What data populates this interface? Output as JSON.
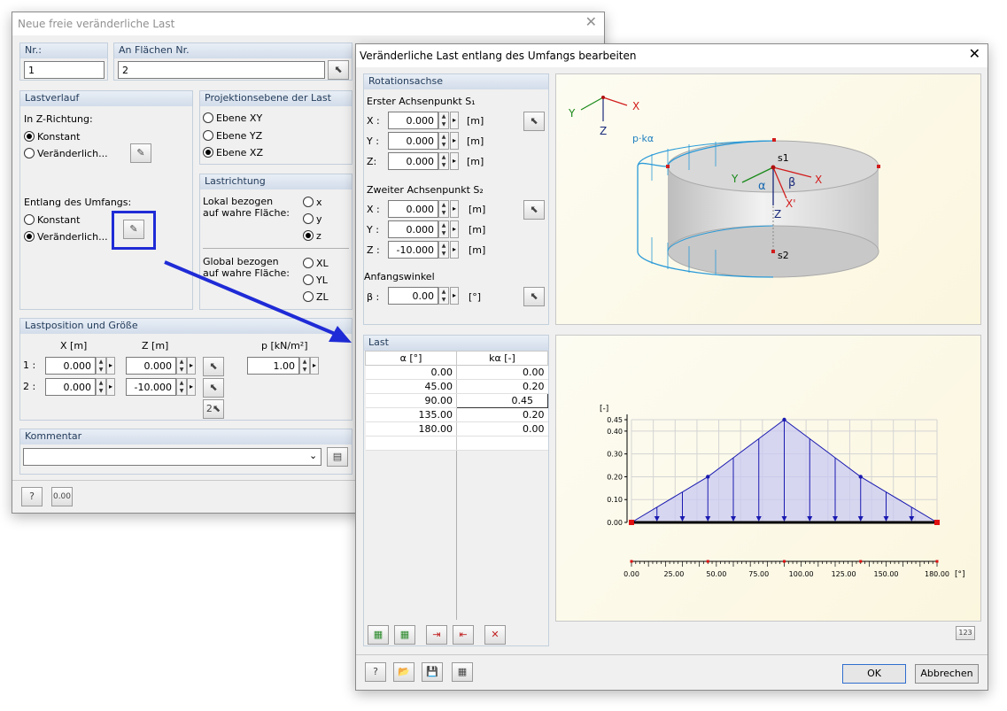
{
  "w1": {
    "title": "Neue freie veränderliche Last",
    "nr_label": "Nr.:",
    "nr_value": "1",
    "faces_label": "An Flächen Nr.",
    "faces_value": "2",
    "lastverlauf": {
      "title": "Lastverlauf",
      "z_label": "In Z-Richtung:",
      "konstant": "Konstant",
      "veraenderlich": "Veränderlich...",
      "umfang_label": "Entlang des Umfangs:"
    },
    "projektion": {
      "title": "Projektionsebene der Last",
      "xy": "Ebene XY",
      "yz": "Ebene YZ",
      "xz": "Ebene XZ"
    },
    "richtung": {
      "title": "Lastrichtung",
      "lokal": "Lokal bezogen auf wahre Fläche:",
      "x": "x",
      "y": "y",
      "z": "z",
      "global": "Global bezogen auf wahre Fläche:",
      "xl": "XL",
      "yl": "YL",
      "zl": "ZL"
    },
    "position": {
      "title": "Lastposition und Größe",
      "col_x": "X [m]",
      "col_z": "Z  [m]",
      "col_p": "p  [kN/m²]",
      "rows": [
        {
          "label": "1 :",
          "x": "0.000",
          "z": "0.000",
          "p": "1.00"
        },
        {
          "label": "2 :",
          "x": "0.000",
          "z": "-10.000"
        }
      ]
    },
    "kommentar": {
      "title": "Kommentar",
      "value": ""
    }
  },
  "w2": {
    "title": "Veränderliche Last entlang des Umfangs bearbeiten",
    "rot": {
      "title": "Rotationsachse",
      "s1_label": "Erster Achsenpunkt S₁",
      "s2_label": "Zweiter Achsenpunkt S₂",
      "unit_m": "[m]",
      "unit_deg": "[°]",
      "s1": [
        {
          "label": "X :",
          "value": "0.000"
        },
        {
          "label": "Y :",
          "value": "0.000"
        },
        {
          "label": "Z:",
          "value": "0.000"
        }
      ],
      "s2": [
        {
          "label": "X :",
          "value": "0.000"
        },
        {
          "label": "Y :",
          "value": "0.000"
        },
        {
          "label": "Z :",
          "value": "-10.000"
        }
      ],
      "angle_label": "Anfangswinkel",
      "beta_label": "β :",
      "beta_value": "0.00"
    },
    "last": {
      "title": "Last",
      "col_alpha": "α [°]",
      "col_k": "kα [-]",
      "rows": [
        {
          "a": "0.00",
          "k": "0.00"
        },
        {
          "a": "45.00",
          "k": "0.20"
        },
        {
          "a": "90.00",
          "k": "0.45"
        },
        {
          "a": "135.00",
          "k": "0.20"
        },
        {
          "a": "180.00",
          "k": "0.00"
        }
      ]
    },
    "diagram": {
      "axes_x": "X",
      "axes_y": "Y",
      "axes_z": "Z",
      "pk": "p·kα",
      "s1": "s1",
      "s2": "s2",
      "alpha": "α",
      "beta": "β",
      "xp": "X'",
      "lx": "X",
      "ly": "Y",
      "lz": "Z"
    },
    "ok": "OK",
    "cancel": "Abbrechen"
  },
  "chart_data": {
    "type": "area",
    "x": [
      0,
      15,
      30,
      45,
      60,
      75,
      90,
      105,
      120,
      135,
      150,
      165,
      180
    ],
    "y": [
      0,
      0.0667,
      0.1333,
      0.2,
      0.2833,
      0.3667,
      0.45,
      0.3667,
      0.2833,
      0.2,
      0.1333,
      0.0667,
      0
    ],
    "points_x": [
      0,
      45,
      90,
      135,
      180
    ],
    "points_y": [
      0,
      0.2,
      0.45,
      0.2,
      0
    ],
    "xticks": [
      "0.00",
      "25.00",
      "50.00",
      "75.00",
      "100.00",
      "125.00",
      "150.00",
      "180.00"
    ],
    "yticks": [
      "0.00",
      "0.10",
      "0.20",
      "0.30",
      "0.40",
      "0.45"
    ],
    "xunit": "[°]",
    "yunit": "[-]",
    "xlim": [
      0,
      180
    ],
    "ylim": [
      0,
      0.45
    ],
    "grid": true,
    "fill": "#c8c8f4",
    "stroke": "#1a1ab0"
  }
}
